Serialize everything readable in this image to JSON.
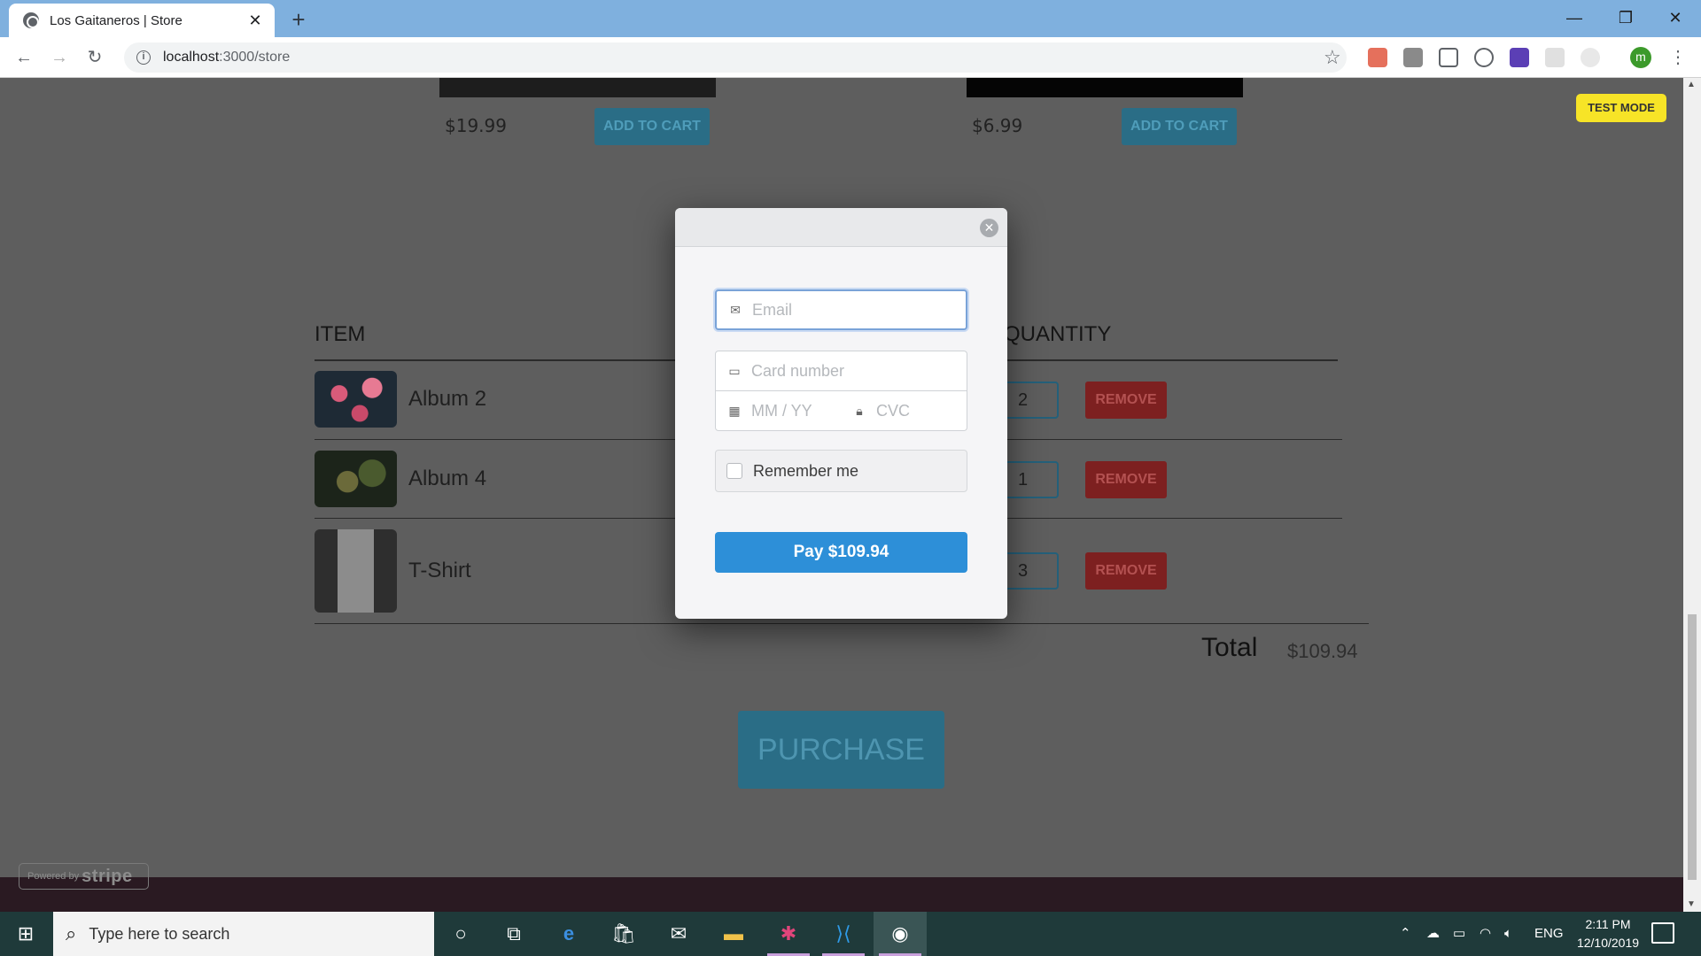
{
  "browser": {
    "tab_title": "Los Gaitaneros | Store",
    "url_host": "localhost",
    "url_port_path": ":3000/store"
  },
  "store": {
    "products": [
      {
        "price": "$19.99",
        "button": "ADD TO CART"
      },
      {
        "price": "$6.99",
        "button": "ADD TO CART"
      }
    ],
    "test_mode_badge": "TEST MODE"
  },
  "cart": {
    "headers": {
      "item": "ITEM",
      "quantity": "QUANTITY"
    },
    "rows": [
      {
        "name": "Album 2",
        "quantity": "2",
        "remove": "REMOVE"
      },
      {
        "name": "Album 4",
        "quantity": "1",
        "remove": "REMOVE"
      },
      {
        "name": "T-Shirt",
        "quantity": "3",
        "remove": "REMOVE"
      }
    ],
    "total_label": "Total",
    "total_value": "$109.94",
    "purchase": "PURCHASE"
  },
  "checkout_modal": {
    "email_placeholder": "Email",
    "card_placeholder": "Card number",
    "expiry_placeholder": "MM / YY",
    "cvc_placeholder": "CVC",
    "remember_label": "Remember me",
    "pay_button": "Pay $109.94"
  },
  "powered_by": {
    "prefix": "Powered by",
    "brand": "stripe"
  },
  "taskbar": {
    "search_placeholder": "Type here to search",
    "language": "ENG",
    "time": "2:11 PM",
    "date": "12/10/2019"
  },
  "colors": {
    "pay_blue": "#2d8fd8",
    "test_mode_yellow": "#f7e427",
    "remove_red": "#7d2020",
    "cart_button_teal": "#2a6d86"
  }
}
